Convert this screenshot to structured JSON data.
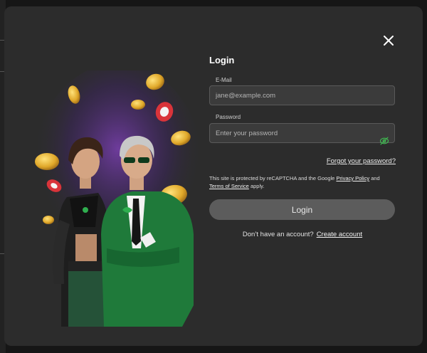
{
  "login": {
    "title": "Login",
    "email_label": "E-Mail",
    "email_placeholder": "jane@example.com",
    "password_label": "Password",
    "password_placeholder": "Enter your password",
    "forgot_link": "Forgot your password?",
    "recaptcha_prefix": "This site is protected by reCAPTCHA and the Google ",
    "privacy_link": "Privacy Policy",
    "recaptcha_and": " and ",
    "terms_link": "Terms of Service",
    "recaptcha_suffix": " apply.",
    "submit_label": "Login",
    "no_account_text": "Don’t have an account?",
    "create_account_link": "Create account"
  },
  "icons": {
    "close": "close-icon",
    "visibility": "eye-off-icon"
  },
  "colors": {
    "modal_bg": "#2c2c2c",
    "input_bg": "#3b3b3b",
    "button_bg": "#5c5c5c",
    "eye_icon": "#3fb950",
    "suit_green": "#1f7a3a",
    "coin_gold": "#e8b830"
  }
}
